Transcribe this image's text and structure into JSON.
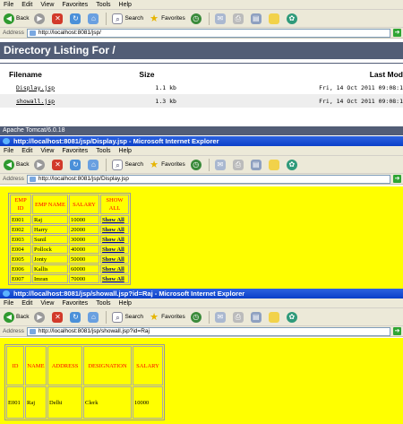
{
  "menu": [
    "File",
    "Edit",
    "View",
    "Favorites",
    "Tools",
    "Help"
  ],
  "toolbar": {
    "back": "Back",
    "search": "Search",
    "favorites": "Favorites"
  },
  "address_label": "Address",
  "colors": {
    "tomcat_header": "#525d76",
    "page_bg": "#ffff00",
    "header_text": "#ff0000",
    "titlebar": "#0a3fc8"
  },
  "window1": {
    "address": "http://localhost:8081/jsp/",
    "heading": "Directory Listing For /",
    "columns": [
      "Filename",
      "Size",
      "Last Mod"
    ],
    "rows": [
      {
        "name": "Display.jsp",
        "size": "1.1 kb",
        "modified": "Fri, 14 Oct 2011 09:08:1"
      },
      {
        "name": "showall.jsp",
        "size": "1.3 kb",
        "modified": "Fri, 14 Oct 2011 09:08:1"
      }
    ],
    "footer": "Apache Tomcat/6.0.18"
  },
  "window2": {
    "title": "http://localhost:8081/jsp/Display.jsp - Microsoft Internet Explorer",
    "address": "http://localhost:8081/jsp/Display.jsp",
    "columns": [
      "EMP ID",
      "EMP NAME",
      "SALARY",
      "SHOW ALL"
    ],
    "rows": [
      {
        "id": "E001",
        "name": "Raj",
        "salary": "10000",
        "link": "Show All"
      },
      {
        "id": "E002",
        "name": "Harry",
        "salary": "20000",
        "link": "Show All"
      },
      {
        "id": "E003",
        "name": "Sunil",
        "salary": "30000",
        "link": "Show All"
      },
      {
        "id": "E004",
        "name": "Pollock",
        "salary": "40000",
        "link": "Show All"
      },
      {
        "id": "E005",
        "name": "Jonty",
        "salary": "50000",
        "link": "Show All"
      },
      {
        "id": "E006",
        "name": "Kallis",
        "salary": "60000",
        "link": "Show All"
      },
      {
        "id": "E007",
        "name": "Imran",
        "salary": "70000",
        "link": "Show All"
      }
    ]
  },
  "window3": {
    "title": "http://localhost:8081/jsp/showall.jsp?id=Raj - Microsoft Internet Explorer",
    "address": "http://localhost:8081/jsp/showall.jsp?id=Raj",
    "columns": [
      "ID",
      "NAME",
      "ADDRESS",
      "DESIGNATION",
      "SALARY"
    ],
    "row": {
      "id": "E001",
      "name": "Raj",
      "address": "Delhi",
      "designation": "Clerk",
      "salary": "10000"
    }
  }
}
